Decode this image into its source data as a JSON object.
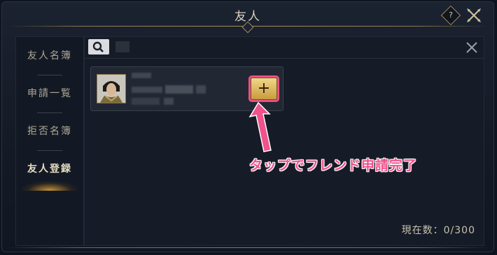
{
  "header": {
    "title": "友人",
    "help_label": "?"
  },
  "sidebar": {
    "items": [
      {
        "label": "友人名簿"
      },
      {
        "label": "申請一覧"
      },
      {
        "label": "拒否名簿"
      },
      {
        "label": "友人登録"
      }
    ]
  },
  "main": {
    "count_label": "現在数：",
    "count_value": "0/300"
  },
  "annotation": {
    "text": "タップでフレンド申請完了",
    "color": "#f0528c"
  },
  "colors": {
    "accent": "#a68f5c",
    "add_button": "#e6c46a"
  }
}
